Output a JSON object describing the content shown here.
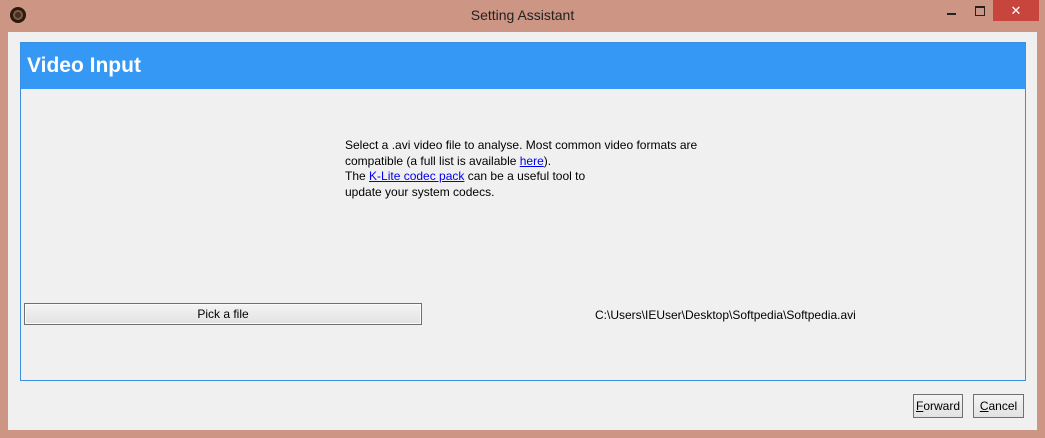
{
  "window": {
    "title": "Setting Assistant",
    "controls": {
      "close_glyph": "✕"
    }
  },
  "panel": {
    "title": "Video Input",
    "desc": {
      "line1": "Select a .avi video file to analyse.  Most common video formats are",
      "line2_prefix": "compatible (a full list is available ",
      "here_link": "here",
      "line2_suffix": ").",
      "line3_prefix": "The ",
      "klite_link": "K-Lite codec pack",
      "line3_suffix": " can be a useful tool to",
      "line4": "update your system codecs."
    },
    "pick_button": "Pick a file",
    "file_path": "C:\\Users\\IEUser\\Desktop\\Softpedia\\Softpedia.avi"
  },
  "footer": {
    "forward_first": "F",
    "forward_rest": "orward",
    "cancel_first": "C",
    "cancel_rest": "ancel"
  }
}
